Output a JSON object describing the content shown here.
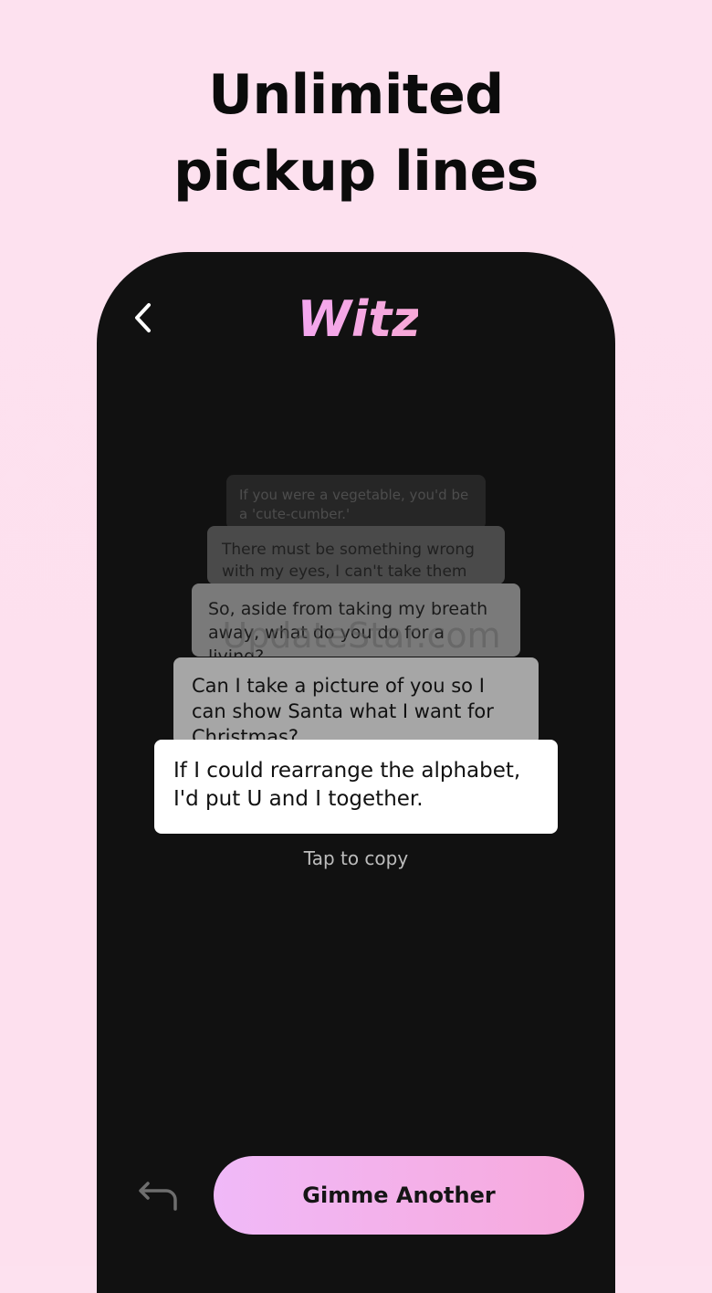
{
  "headline": {
    "line1": "Unlimited",
    "line2": "pickup lines"
  },
  "app": {
    "logo_text": "Witz"
  },
  "cards": [
    "If you were a vegetable, you'd be a 'cute-cumber.'",
    "There must be something wrong with my eyes, I can't take them",
    "So, aside from taking my breath away, what do you do for a living?",
    "Can I take a picture of you so I can show Santa what I want for Christmas?",
    "If I could rearrange the alphabet, I'd put U and I together."
  ],
  "watermark": "UpdateStar.com",
  "hint": "Tap to copy",
  "cta_label": "Gimme Another",
  "icons": {
    "back": "chevron-left-icon",
    "undo": "undo-arrow-icon"
  },
  "colors": {
    "background": "#fde1ef",
    "phone": "#111111",
    "logo_gradient_start": "#f4a7f0",
    "logo_gradient_end": "#f6a8d6",
    "cta_gradient_start": "#f0b9f8",
    "cta_gradient_end": "#f7a9dc"
  }
}
